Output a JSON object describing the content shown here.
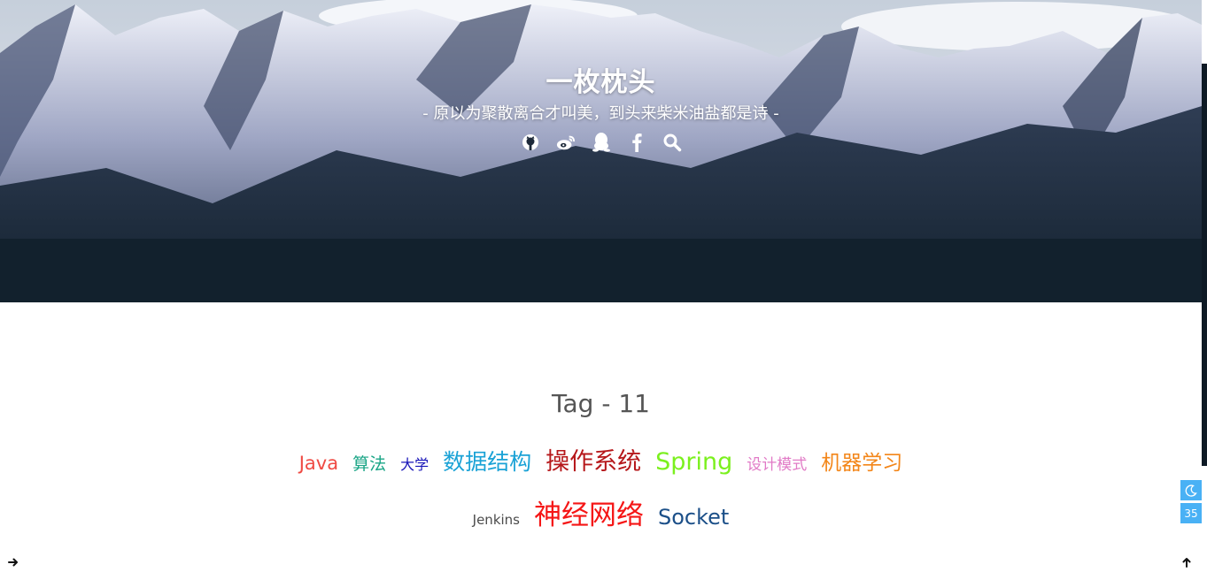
{
  "header": {
    "site_title": "一枚枕头",
    "subtitle": "- 原以为聚散离合才叫美，到头来柴米油盐都是诗 -",
    "social_icons": [
      "github-icon",
      "weibo-icon",
      "qq-icon",
      "facebook-icon",
      "search-icon"
    ]
  },
  "main": {
    "heading": "Tag - 11",
    "tags": [
      {
        "label": "Java",
        "color": "#ef4a43"
      },
      {
        "label": "算法",
        "color": "#1aa586"
      },
      {
        "label": "大学",
        "color": "#1714b8"
      },
      {
        "label": "数据结构",
        "color": "#1aa2d6"
      },
      {
        "label": "操作系统",
        "color": "#b6181b"
      },
      {
        "label": "Spring",
        "color": "#7bf01e"
      },
      {
        "label": "设计模式",
        "color": "#e17ac6"
      },
      {
        "label": "机器学习",
        "color": "#f38619"
      },
      {
        "label": "Jenkins",
        "color": "#4b4b4b"
      },
      {
        "label": "神经网络",
        "color": "#f51616"
      },
      {
        "label": "Socket",
        "color": "#1b4f88"
      }
    ]
  },
  "rightside": {
    "dark_mode_icon": "moon-icon",
    "counter_label": "35",
    "accent_color": "#49b1f5"
  },
  "corners": {
    "left_icon": "arrow-right-icon",
    "right_icon": "arrow-up-icon"
  }
}
